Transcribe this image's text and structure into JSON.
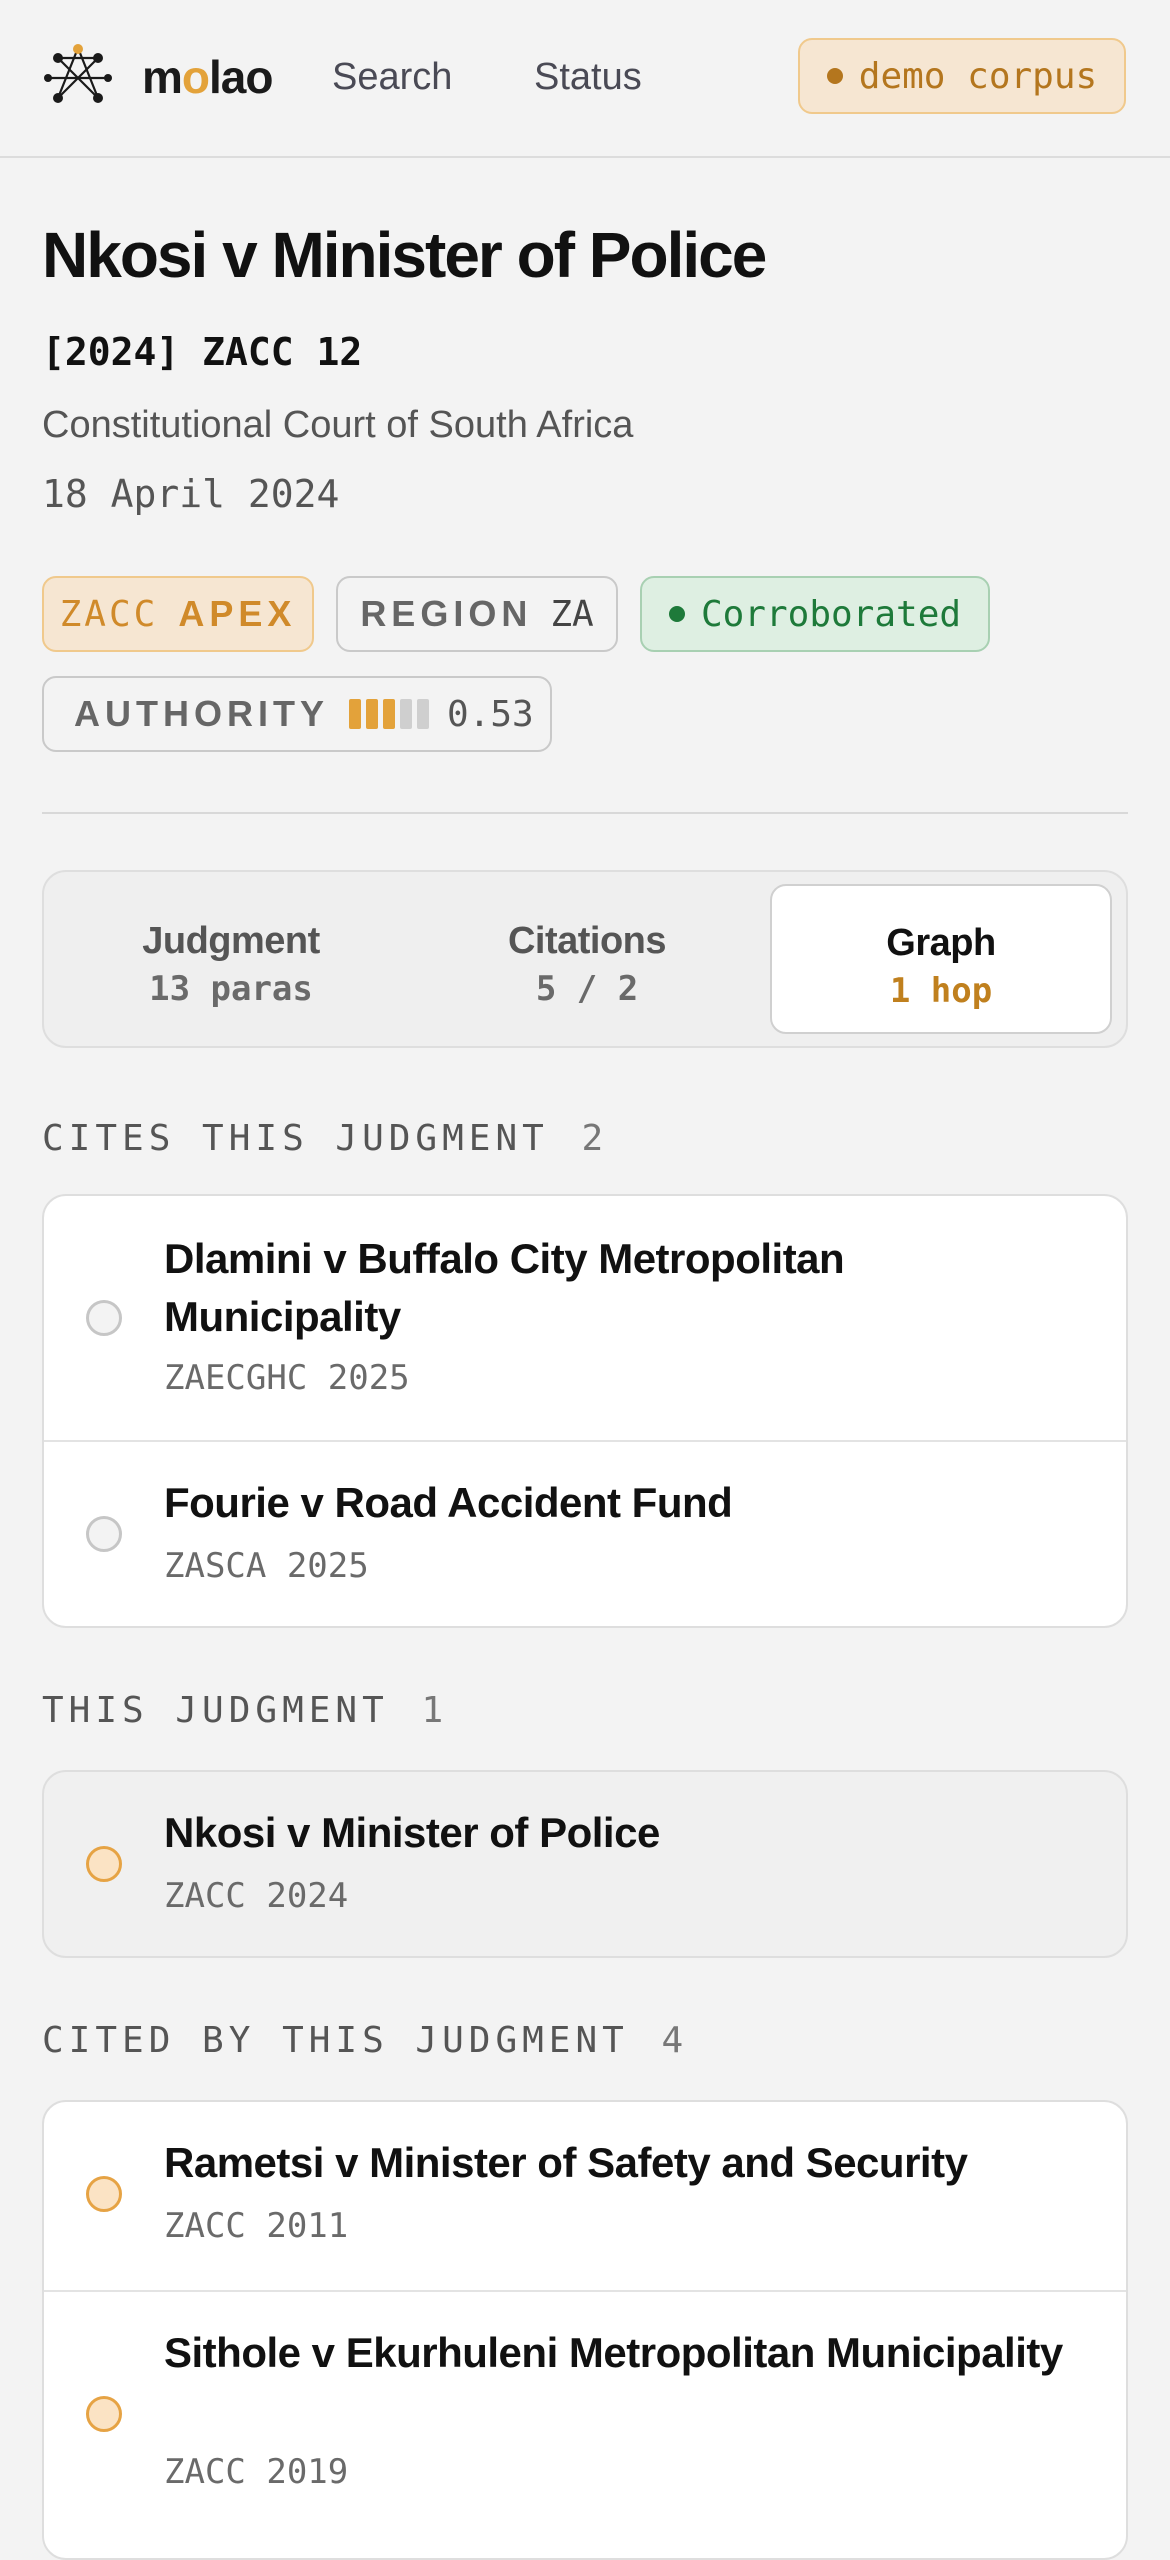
{
  "brand": {
    "name_prefix": "m",
    "name_o": "o",
    "name_suffix": "lao",
    "icon": "network-graph-logo-icon"
  },
  "nav": {
    "search": "Search",
    "status": "Status"
  },
  "corpus_badge": {
    "label": "demo corpus",
    "color": "#b4761e"
  },
  "case": {
    "title": "Nkosi v Minister of Police",
    "citation": "[2024] ZACC 12",
    "court": "Constitutional Court of South Africa",
    "date": "18 April 2024"
  },
  "chips": {
    "court_code": "ZACC",
    "tier": "APEX",
    "region_key": "REGION",
    "region_value": "ZA",
    "status": "Corroborated",
    "status_color": "#1e7a3a",
    "authority_key": "AUTHORITY",
    "authority_value": "0.53",
    "authority_level": 0.53
  },
  "tabs": [
    {
      "label": "Judgment",
      "sub": "13 paras"
    },
    {
      "label": "Citations",
      "sub": "5 / 2"
    },
    {
      "label": "Graph",
      "sub": "1 hop"
    }
  ],
  "sections": {
    "cites": {
      "title": "CITES THIS JUDGMENT",
      "count": "2",
      "items": [
        {
          "title": "Dlamini v Buffalo City Metropolitan Municipality",
          "meta": "ZAECGHC 2025"
        },
        {
          "title": "Fourie v Road Accident Fund",
          "meta": "ZASCA 2025"
        }
      ]
    },
    "self": {
      "title": "THIS JUDGMENT",
      "count": "1",
      "items": [
        {
          "title": "Nkosi v Minister of Police",
          "meta": "ZACC 2024"
        }
      ]
    },
    "cited_by": {
      "title": "CITED BY THIS JUDGMENT",
      "count": "4",
      "items": [
        {
          "title": "Rametsi v Minister of Safety and Security",
          "meta": "ZACC 2011"
        },
        {
          "title": "Sithole v Ekurhuleni Metropolitan Municipality",
          "meta": "ZACC 2019"
        }
      ]
    }
  },
  "colors": {
    "accent": "#e3a23a",
    "background": "#f3f3f3"
  }
}
